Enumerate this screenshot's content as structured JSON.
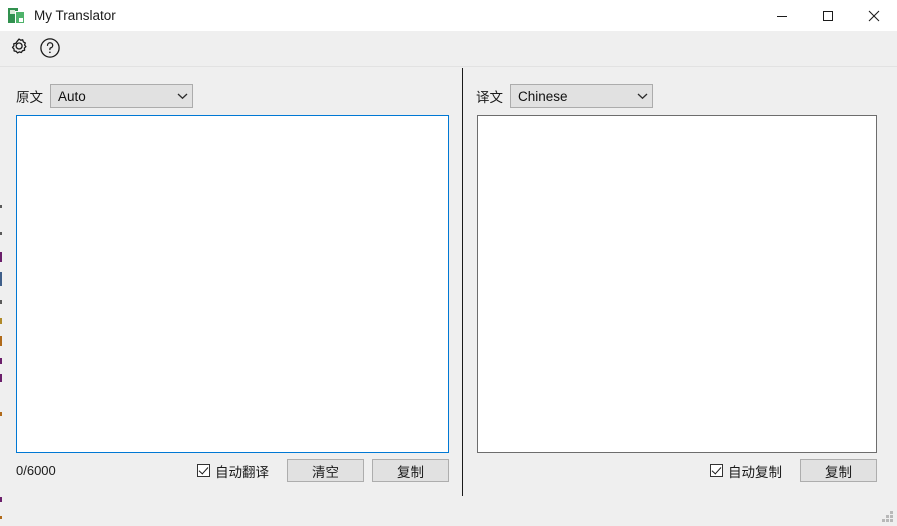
{
  "window": {
    "title": "My Translator",
    "icon": "spreadsheet-translate-icon",
    "controls": {
      "minimize": "minimize-icon",
      "maximize": "maximize-icon",
      "close": "close-icon"
    }
  },
  "toolbar": {
    "settings_icon": "gear-icon",
    "help_icon": "question-circle-icon"
  },
  "source_panel": {
    "label": "原文",
    "language": "Auto",
    "language_options": [
      "Auto"
    ],
    "text": "",
    "placeholder": "",
    "char_counter": "0/6000",
    "auto_translate_label": "自动翻译",
    "auto_translate_checked": true,
    "clear_button": "清空",
    "copy_button": "复制"
  },
  "target_panel": {
    "label": "译文",
    "language": "Chinese",
    "language_options": [
      "Chinese"
    ],
    "text": "",
    "placeholder": "",
    "auto_copy_label": "自动复制",
    "auto_copy_checked": true,
    "copy_button": "复制"
  },
  "colors": {
    "focus_border": "#0078d4",
    "idle_border": "#6d6d6d",
    "window_background": "#efefef",
    "titlebar_background": "#ffffff",
    "button_face": "#e1e1e1"
  }
}
